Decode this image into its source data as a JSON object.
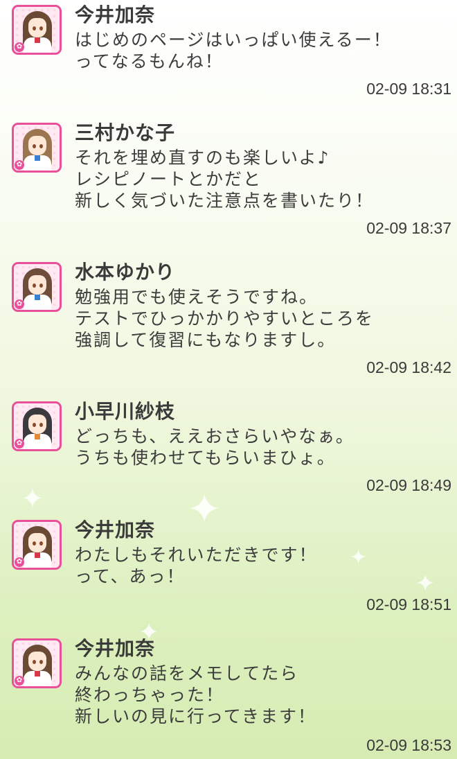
{
  "messages": [
    {
      "name": "今井加奈",
      "lines": [
        "はじめのページはいっぱい使えるー！",
        "ってなるもんね！"
      ],
      "time": "02-09 18:31",
      "hair": "#6b4a33",
      "tie": "#d9384a"
    },
    {
      "name": "三村かな子",
      "lines": [
        "それを埋め直すのも楽しいよ♪",
        "レシピノートとかだと",
        "新しく気づいた注意点を書いたり！"
      ],
      "time": "02-09 18:37",
      "hair": "#9b7450",
      "tie": "#3b7fd4"
    },
    {
      "name": "水本ゆかり",
      "lines": [
        "勉強用でも使えそうですね。",
        "テストでひっかかりやすいところを",
        "強調して復習にもなりますし。"
      ],
      "time": "02-09 18:42",
      "hair": "#6e4e3a",
      "tie": "#3b7fd4"
    },
    {
      "name": "小早川紗枝",
      "lines": [
        "どっちも、ええおさらいやなぁ。",
        "うちも使わせてもらいまひょ。"
      ],
      "time": "02-09 18:49",
      "hair": "#3a3a3f",
      "tie": "#e08a3a"
    },
    {
      "name": "今井加奈",
      "lines": [
        "わたしもそれいただきです！",
        "って、あっ！"
      ],
      "time": "02-09 18:51",
      "hair": "#6b4a33",
      "tie": "#d9384a"
    },
    {
      "name": "今井加奈",
      "lines": [
        "みんなの話をメモしてたら",
        "終わっちゃった！",
        "新しいの見に行ってきます！"
      ],
      "time": "02-09 18:53",
      "hair": "#6b4a33",
      "tie": "#d9384a"
    }
  ]
}
